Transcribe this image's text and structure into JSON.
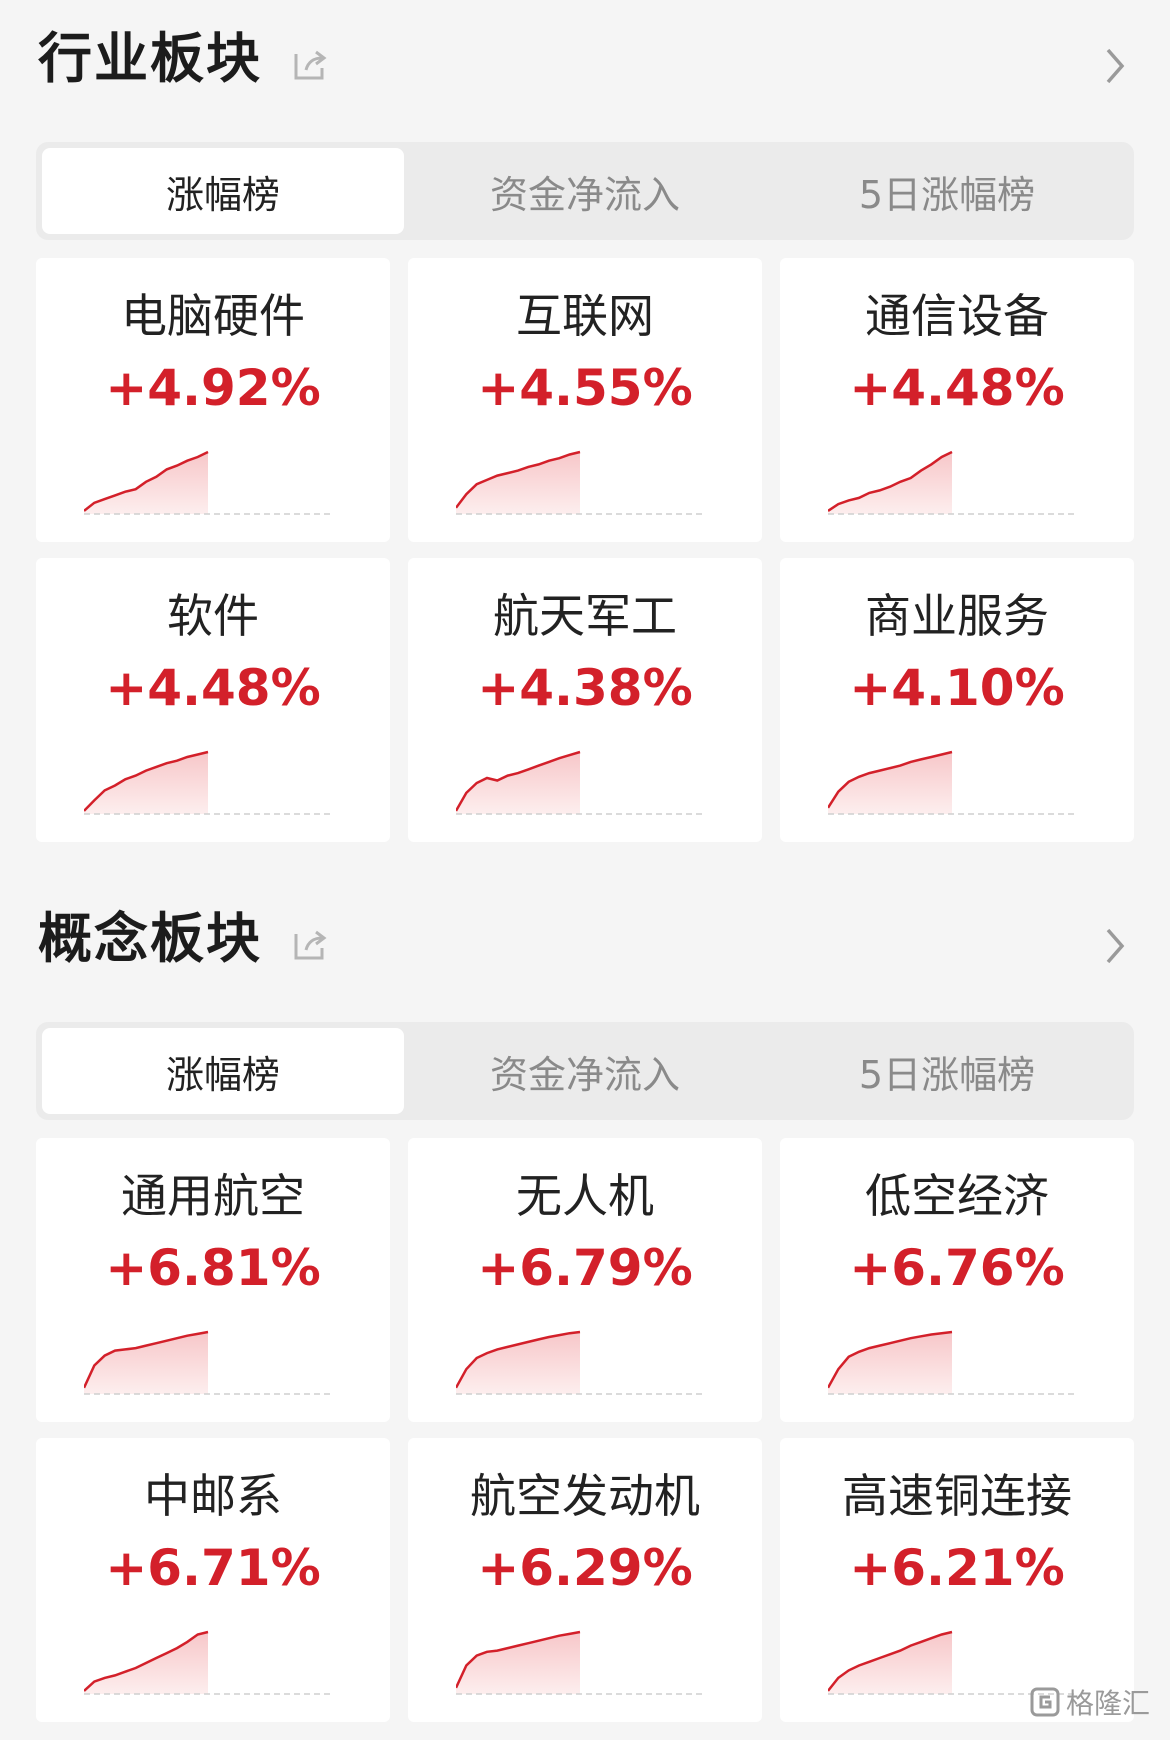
{
  "colors": {
    "up": "#d3202a",
    "fill": "#f7c7c9"
  },
  "sections": [
    {
      "title": "行业板块",
      "tabs": [
        "涨幅榜",
        "资金净流入",
        "5日涨幅榜"
      ],
      "active_tab": 0,
      "cards": [
        {
          "name": "电脑硬件",
          "change": "+4.92%",
          "trend": [
            0.05,
            0.18,
            0.24,
            0.3,
            0.36,
            0.4,
            0.52,
            0.6,
            0.72,
            0.78,
            0.86,
            0.92,
            1.0
          ]
        },
        {
          "name": "互联网",
          "change": "+4.55%",
          "trend": [
            0.1,
            0.32,
            0.48,
            0.55,
            0.62,
            0.66,
            0.7,
            0.76,
            0.8,
            0.86,
            0.9,
            0.96,
            1.0
          ]
        },
        {
          "name": "通信设备",
          "change": "+4.48%",
          "trend": [
            0.05,
            0.16,
            0.22,
            0.26,
            0.34,
            0.38,
            0.44,
            0.52,
            0.58,
            0.7,
            0.8,
            0.92,
            1.0
          ]
        },
        {
          "name": "软件",
          "change": "+4.48%",
          "trend": [
            0.05,
            0.22,
            0.38,
            0.46,
            0.56,
            0.62,
            0.7,
            0.76,
            0.82,
            0.86,
            0.92,
            0.96,
            1.0
          ]
        },
        {
          "name": "航天军工",
          "change": "+4.38%",
          "trend": [
            0.05,
            0.34,
            0.5,
            0.58,
            0.54,
            0.62,
            0.66,
            0.72,
            0.78,
            0.84,
            0.9,
            0.95,
            1.0
          ]
        },
        {
          "name": "商业服务",
          "change": "+4.10%",
          "trend": [
            0.1,
            0.36,
            0.52,
            0.6,
            0.66,
            0.7,
            0.74,
            0.78,
            0.84,
            0.88,
            0.92,
            0.96,
            1.0
          ]
        }
      ]
    },
    {
      "title": "概念板块",
      "tabs": [
        "涨幅榜",
        "资金净流入",
        "5日涨幅榜"
      ],
      "active_tab": 0,
      "cards": [
        {
          "name": "通用航空",
          "change": "+6.81%",
          "trend": [
            0.1,
            0.46,
            0.62,
            0.7,
            0.72,
            0.74,
            0.78,
            0.82,
            0.86,
            0.9,
            0.94,
            0.97,
            1.0
          ]
        },
        {
          "name": "无人机",
          "change": "+6.79%",
          "trend": [
            0.1,
            0.4,
            0.58,
            0.66,
            0.72,
            0.76,
            0.8,
            0.84,
            0.88,
            0.92,
            0.95,
            0.98,
            1.0
          ]
        },
        {
          "name": "低空经济",
          "change": "+6.76%",
          "trend": [
            0.1,
            0.4,
            0.6,
            0.68,
            0.74,
            0.78,
            0.82,
            0.86,
            0.9,
            0.93,
            0.96,
            0.98,
            1.0
          ]
        },
        {
          "name": "中邮系",
          "change": "+6.71%",
          "trend": [
            0.05,
            0.2,
            0.26,
            0.3,
            0.36,
            0.42,
            0.5,
            0.58,
            0.66,
            0.74,
            0.84,
            0.96,
            1.0
          ]
        },
        {
          "name": "航空发动机",
          "change": "+6.29%",
          "trend": [
            0.1,
            0.46,
            0.62,
            0.68,
            0.7,
            0.74,
            0.78,
            0.82,
            0.86,
            0.9,
            0.94,
            0.97,
            1.0
          ]
        },
        {
          "name": "高速铜连接",
          "change": "+6.21%",
          "trend": [
            0.05,
            0.26,
            0.38,
            0.46,
            0.52,
            0.58,
            0.64,
            0.7,
            0.78,
            0.84,
            0.9,
            0.96,
            1.0
          ]
        }
      ]
    }
  ],
  "watermark": "格隆汇"
}
